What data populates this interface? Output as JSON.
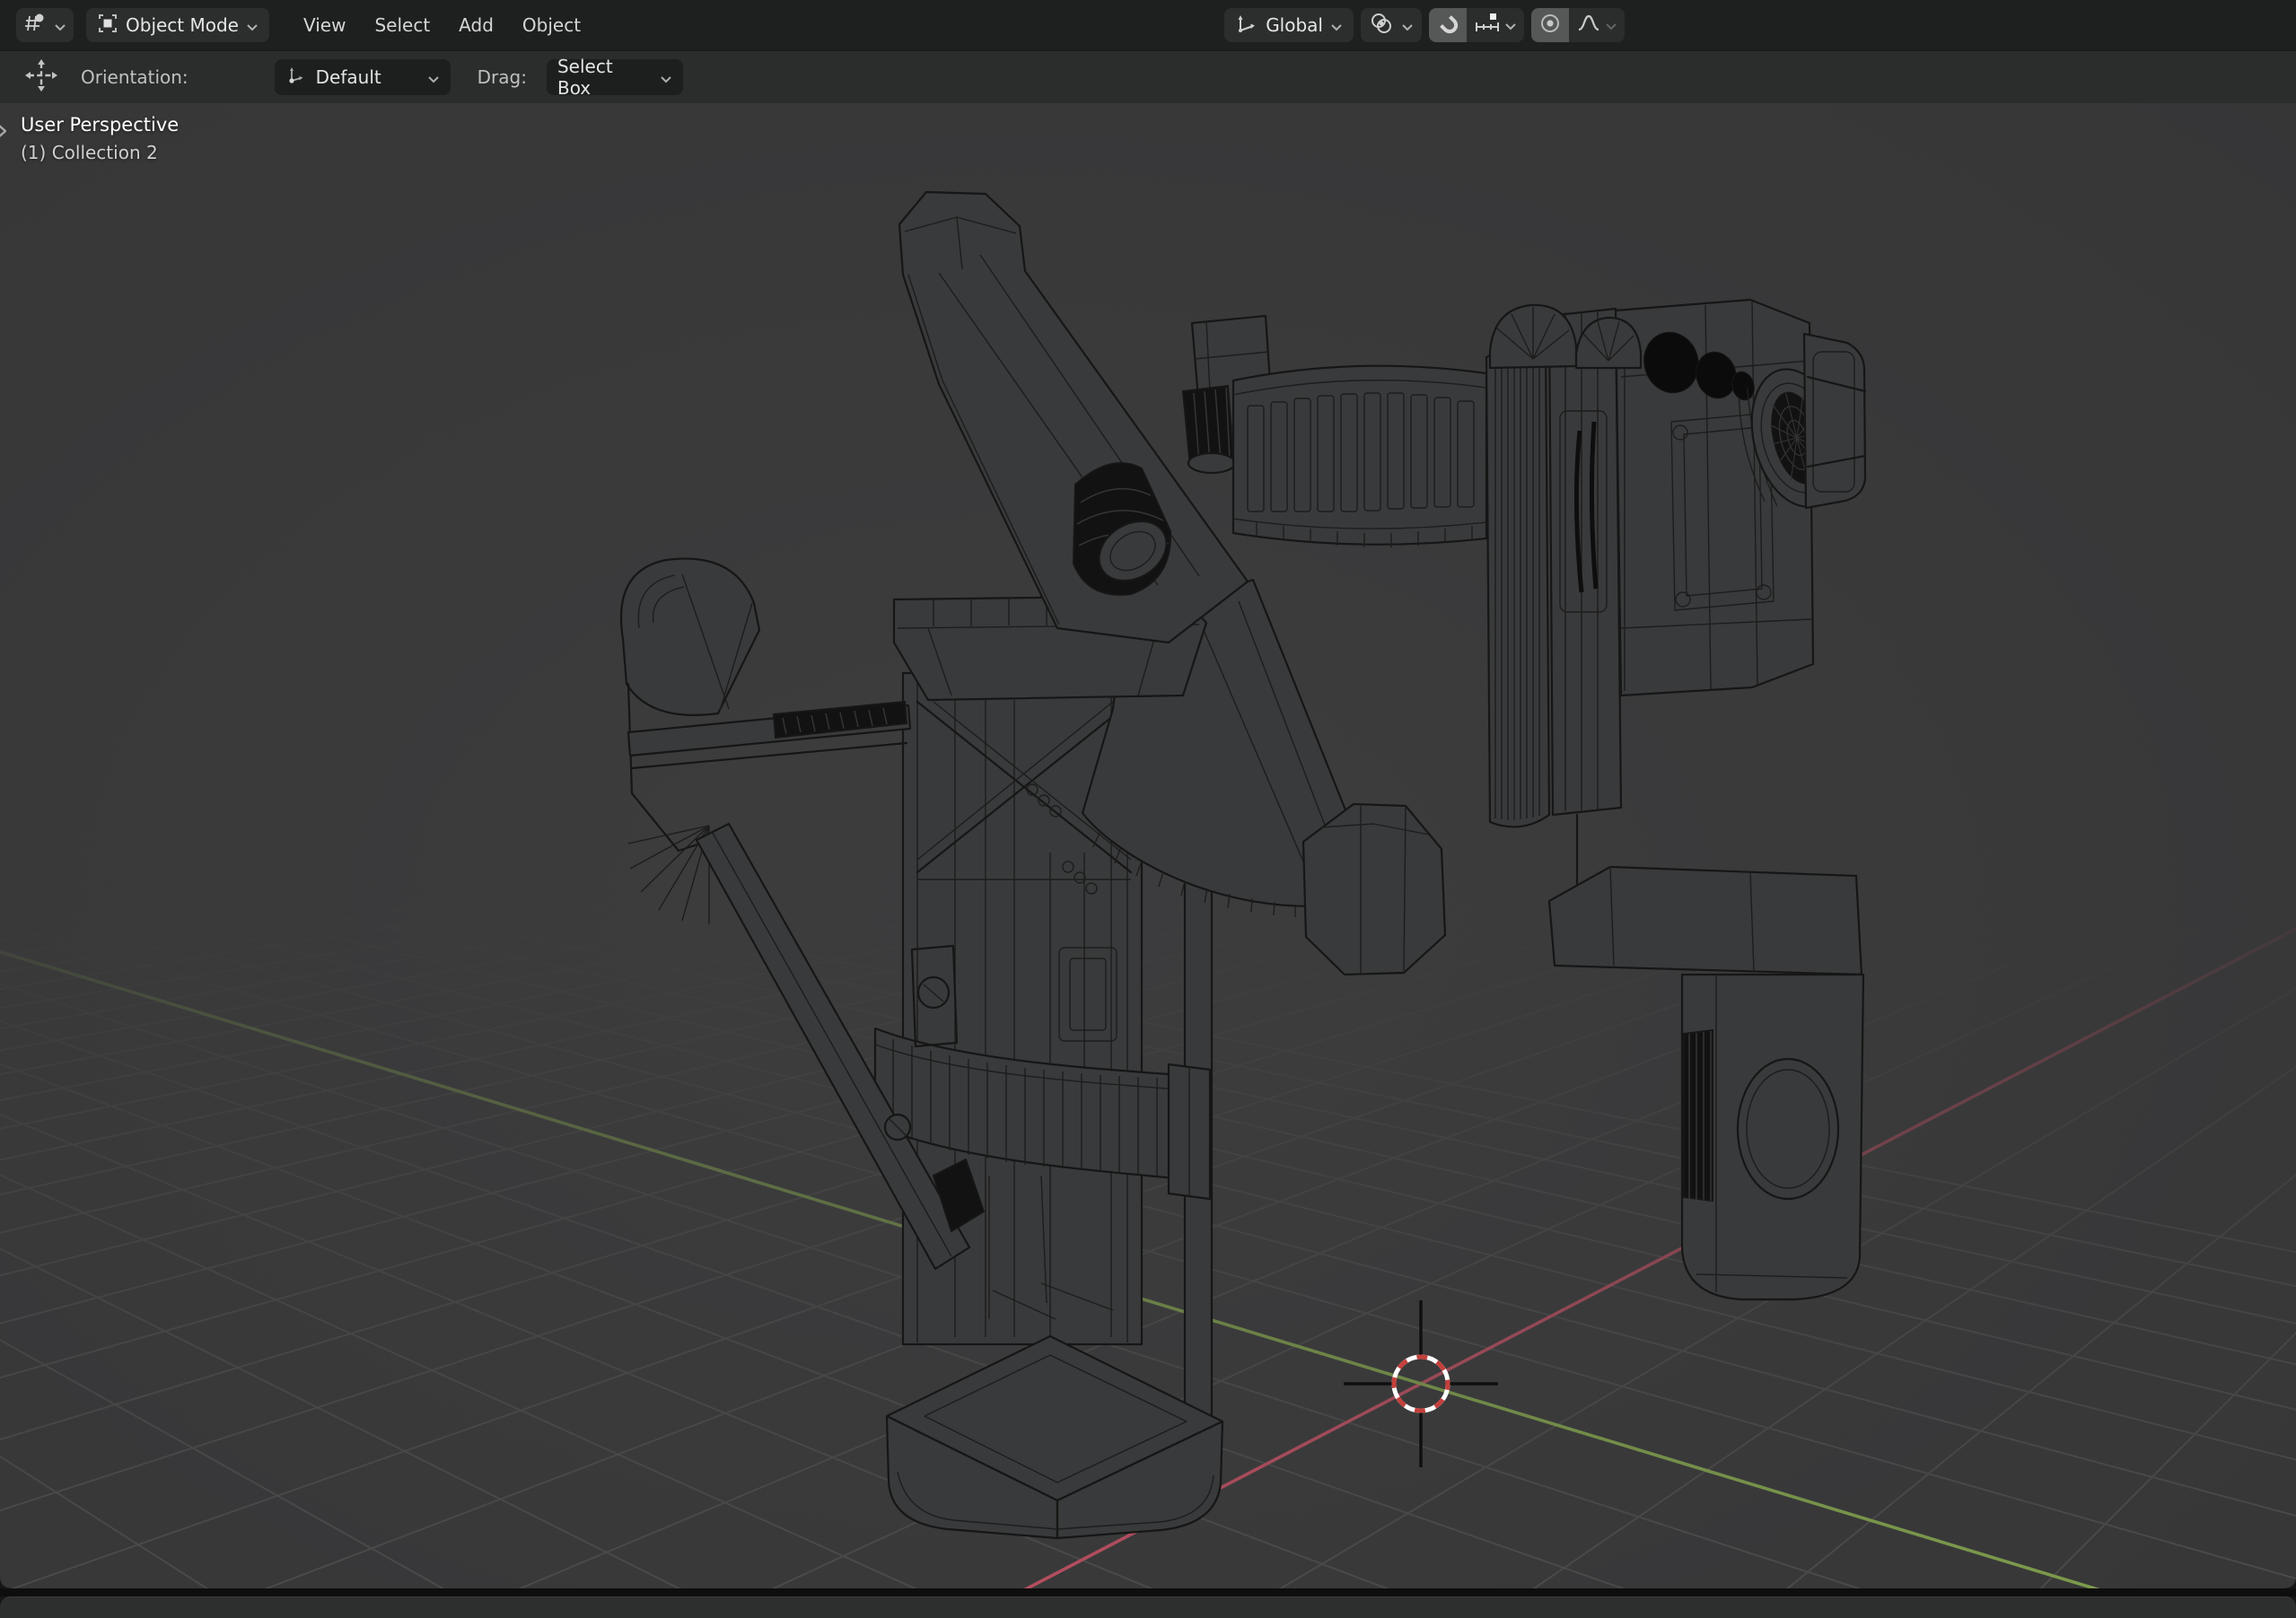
{
  "header": {
    "editor_type_icon": "3d-viewport",
    "mode_label": "Object Mode",
    "menus": [
      {
        "label": "View"
      },
      {
        "label": "Select"
      },
      {
        "label": "Add"
      },
      {
        "label": "Object"
      }
    ],
    "transform_orientation_value": "Global",
    "snap_enabled": true,
    "proportional_editing_enabled": true
  },
  "tool_settings": {
    "active_tool": "move",
    "orientation_label": "Orientation:",
    "orientation_value": "Default",
    "drag_label": "Drag:",
    "drag_value": "Select Box"
  },
  "viewport": {
    "overlay": {
      "line1": "User Perspective",
      "line2": "(1) Collection 2"
    },
    "collapse_chevron": "›",
    "colors": {
      "background_center": "#3d3d3e",
      "background_edge": "#363637",
      "surface": "#393a3b",
      "grid": "#4b4b4c",
      "axis_x": "#b84f60",
      "axis_y": "#7f9e4c",
      "wire": "#161616",
      "cursor_red": "#c4403c",
      "cursor_white": "#ffffff"
    }
  },
  "icons": {
    "editor_type": "3d-viewport-icon",
    "mode": "select-box-icon",
    "transform_orientation": "axes-icon",
    "pivot": "pivot-point-icon",
    "snap": "magnet-icon",
    "snap_target": "increments-icon",
    "proportional": "dot-circle-icon",
    "falloff": "smooth-curve-icon",
    "active_tool": "move-cross-icon",
    "orientation_pref": "axis-origin-icon"
  }
}
